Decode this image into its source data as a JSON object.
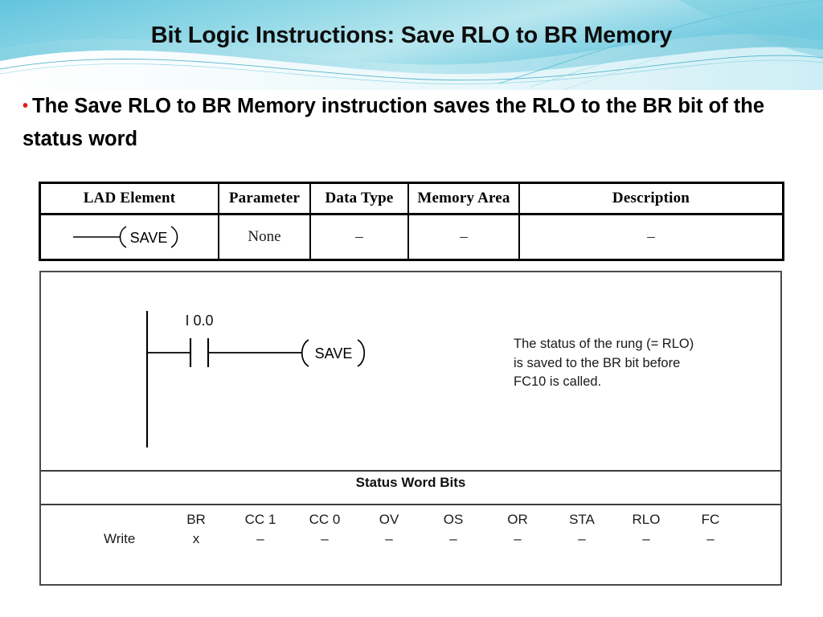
{
  "slide": {
    "title": "Bit Logic Instructions: Save RLO to BR Memory",
    "bullet_marker": "•",
    "bullet_text": "The Save RLO to BR Memory instruction saves the RLO to the BR bit of the status word",
    "accent_color": "#6ec9db",
    "bullet_color": "#e8161b"
  },
  "spec_table": {
    "headers": [
      "LAD Element",
      "Parameter",
      "Data Type",
      "Memory Area",
      "Description"
    ],
    "row": {
      "lad_element_label": "SAVE",
      "parameter": "None",
      "data_type": "–",
      "memory_area": "–",
      "description": "–"
    }
  },
  "diagram": {
    "contact_label": "I 0.0",
    "coil_label": "SAVE",
    "note": "The status of the rung (= RLO)\nis saved to the BR bit before\nFC10 is called.",
    "status_section_title": "Status Word Bits",
    "status_row_label": "Write",
    "status_bits": [
      {
        "label": "BR",
        "overline": false,
        "value": "x"
      },
      {
        "label": "CC 1",
        "overline": false,
        "value": "–"
      },
      {
        "label": "CC 0",
        "overline": false,
        "value": "–"
      },
      {
        "label": "OV",
        "overline": false,
        "value": "–"
      },
      {
        "label": "OS",
        "overline": false,
        "value": "–"
      },
      {
        "label": "OR",
        "overline": false,
        "value": "–"
      },
      {
        "label": "STA",
        "overline": false,
        "value": "–"
      },
      {
        "label": "RLO",
        "overline": false,
        "value": "–"
      },
      {
        "label": "FC",
        "overline": true,
        "value": "–"
      }
    ]
  }
}
